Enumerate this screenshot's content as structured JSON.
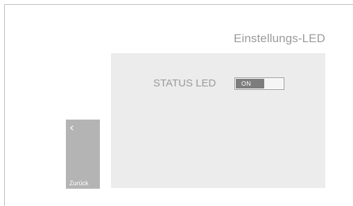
{
  "header": {
    "title": "Einstellungs-LED"
  },
  "settings": {
    "status_led": {
      "label": "STATUS LED",
      "value": "ON"
    }
  },
  "navigation": {
    "back_icon": "chevron-left-icon",
    "back_glyph": "‹",
    "back_label": "Zurück"
  },
  "colors": {
    "panel": "#ececec",
    "toggle_on": "#7d7d7d",
    "back_button": "#b4b4b4",
    "text": "#9a9a9a"
  }
}
